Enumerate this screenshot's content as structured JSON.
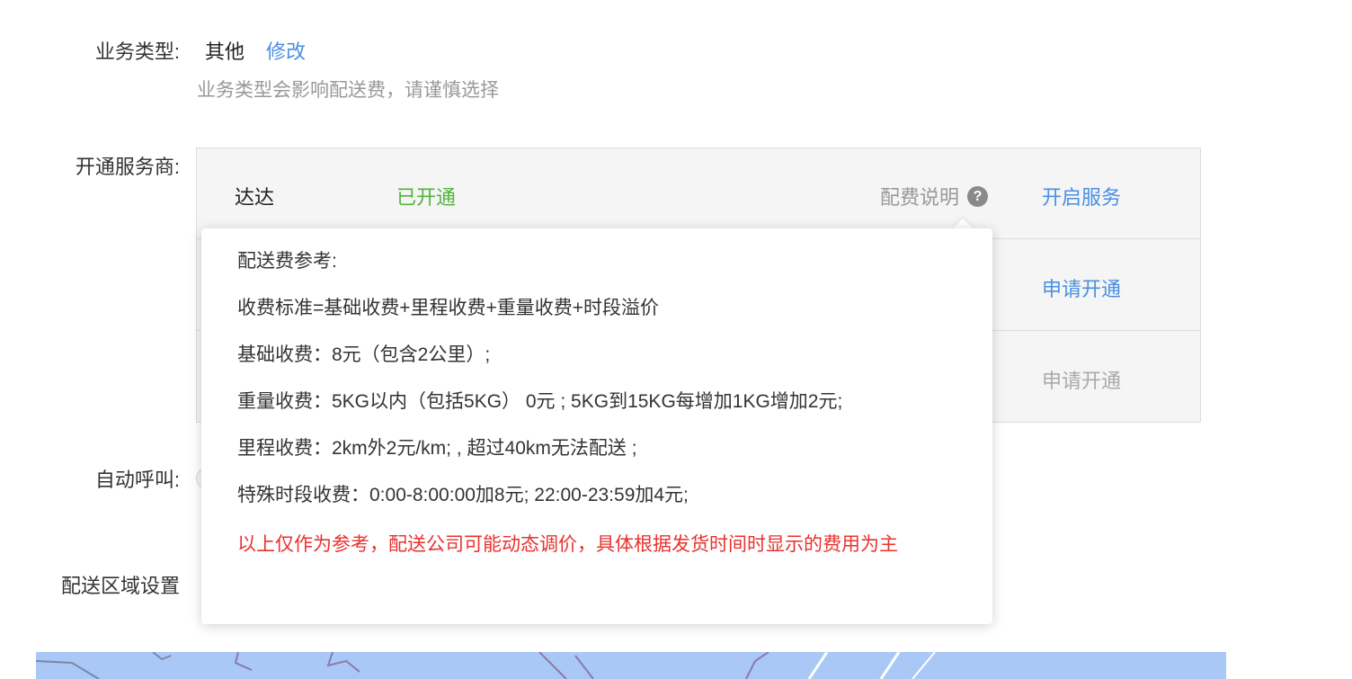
{
  "business_type": {
    "label": "业务类型:",
    "value": "其他",
    "edit_label": "修改",
    "hint": "业务类型会影响配送费，请谨慎选择"
  },
  "providers": {
    "label": "开通服务商:",
    "fee_label": "配费说明",
    "help_icon": "question-circle-icon",
    "rows": [
      {
        "name": "达达",
        "status": "已开通",
        "action": "开启服务",
        "action_enabled": true
      },
      {
        "name": "",
        "status": "",
        "action": "申请开通",
        "action_enabled": true
      },
      {
        "name": "",
        "status": "",
        "action": "申请开通",
        "action_enabled": false
      }
    ]
  },
  "auto_call": {
    "label": "自动呼叫:"
  },
  "delivery_area": {
    "label": "配送区域设置"
  },
  "fee_popover": {
    "title": "配送费参考:",
    "lines": [
      "收费标准=基础收费+里程收费+重量收费+时段溢价",
      "基础收费：8元（包含2公里）;",
      "重量收费：5KG以内（包括5KG） 0元 ; 5KG到15KG每增加1KG增加2元;",
      "里程收费：2km外2元/km; , 超过40km无法配送 ;",
      "特殊时段收费：0:00-8:00:00加8元; 22:00-23:59加4元;"
    ],
    "note": "以上仅作为参考，配送公司可能动态调价，具体根据发货时间时显示的费用为主"
  },
  "colors": {
    "link": "#4a90e2",
    "success": "#52b43a",
    "warning_text": "#e8322e",
    "muted": "#999999",
    "map": "#a9c8f5"
  }
}
